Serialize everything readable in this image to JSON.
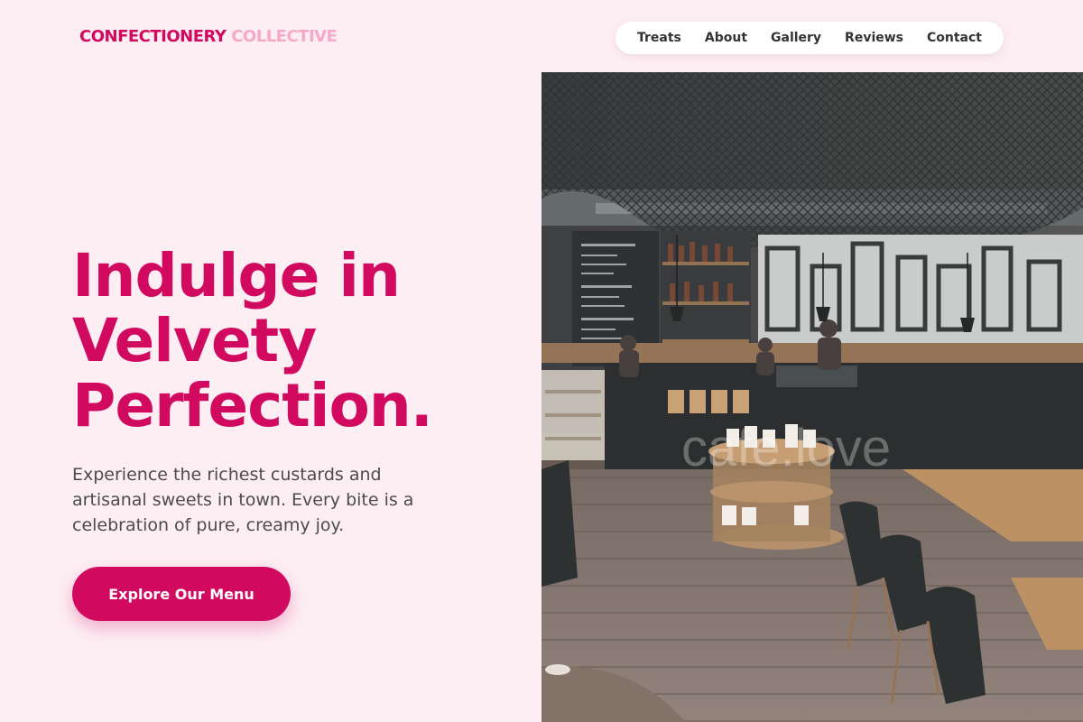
{
  "header": {
    "logo_primary": "CONFECTIONERY",
    "logo_secondary": "COLLECTIVE",
    "nav": [
      "Treats",
      "About",
      "Gallery",
      "Reviews",
      "Contact"
    ]
  },
  "hero": {
    "title_lines": [
      "Indulge in",
      "Velvety",
      "Perfection."
    ],
    "subtitle": "Experience the richest custards and artisanal sweets in town. Every bite is a celebration of pure, creamy joy.",
    "cta_label": "Explore Our Menu"
  },
  "image": {
    "watermark": "cafe.love"
  },
  "colors": {
    "background": "#fdeef4",
    "accent": "#d1095f",
    "accent_light": "#f6a9c6",
    "nav_bg": "#ffffff"
  }
}
